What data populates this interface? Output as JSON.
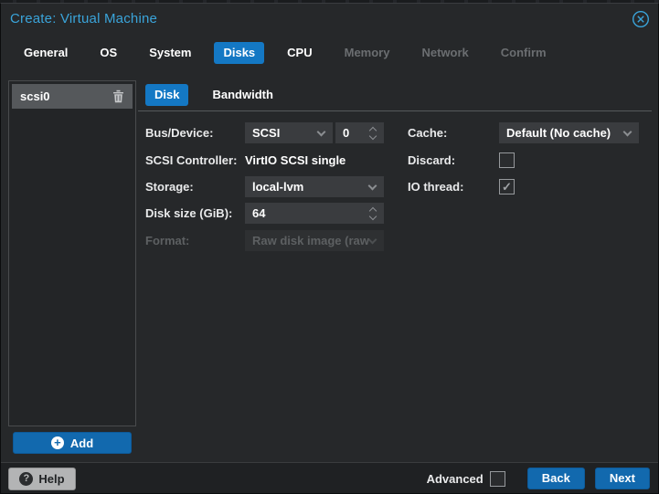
{
  "window": {
    "title": "Create: Virtual Machine",
    "close_icon": "circle-x-icon"
  },
  "wizard_tabs": [
    {
      "label": "General",
      "state": "enabled"
    },
    {
      "label": "OS",
      "state": "enabled"
    },
    {
      "label": "System",
      "state": "enabled"
    },
    {
      "label": "Disks",
      "state": "active"
    },
    {
      "label": "CPU",
      "state": "enabled"
    },
    {
      "label": "Memory",
      "state": "disabled"
    },
    {
      "label": "Network",
      "state": "disabled"
    },
    {
      "label": "Confirm",
      "state": "disabled"
    }
  ],
  "device_list": {
    "selected_item": "scsi0",
    "delete_icon": "trash-icon",
    "add_button_label": "Add",
    "add_icon": "plus-circle-icon"
  },
  "panel_tabs": {
    "disk": "Disk",
    "bandwidth": "Bandwidth",
    "active": "Disk"
  },
  "form": {
    "bus_device_label": "Bus/Device:",
    "bus_value": "SCSI",
    "device_number": "0",
    "controller_label": "SCSI Controller:",
    "controller_value": "VirtIO SCSI single",
    "storage_label": "Storage:",
    "storage_value": "local-lvm",
    "disk_size_label": "Disk size (GiB):",
    "disk_size_value": "64",
    "format_label": "Format:",
    "format_value": "Raw disk image (raw",
    "format_disabled": true,
    "cache_label": "Cache:",
    "cache_value": "Default (No cache)",
    "discard_label": "Discard:",
    "discard_checked": false,
    "io_thread_label": "IO thread:",
    "io_thread_checked": true,
    "checkmark": "✓"
  },
  "footer": {
    "help_label": "Help",
    "help_icon": "question-circle-icon",
    "advanced_label": "Advanced",
    "advanced_checked": false,
    "back_label": "Back",
    "next_label": "Next"
  },
  "colors": {
    "accent_blue": "#1478c4",
    "button_blue": "#1269ae",
    "title_blue": "#3aa4da",
    "dialog_bg": "#26282a",
    "field_bg": "#3a3c3f",
    "selected_item_bg": "#55585b",
    "disabled_text": "#5d6062"
  }
}
